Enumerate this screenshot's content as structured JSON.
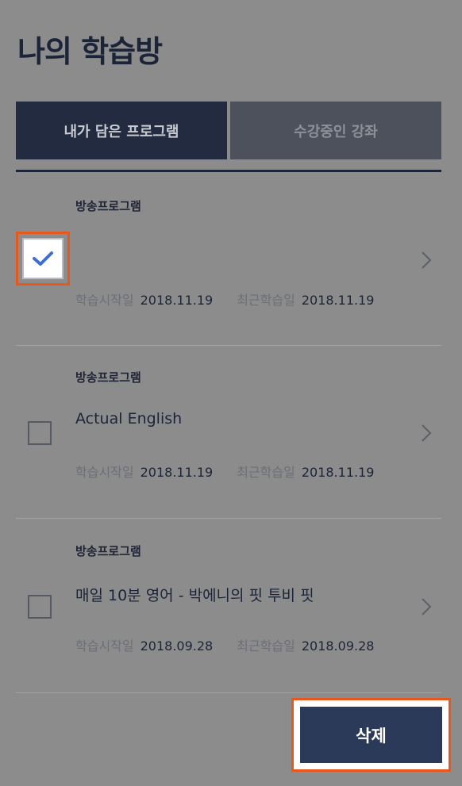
{
  "page_title": "나의 학습방",
  "tabs": [
    {
      "label": "내가 담은 프로그램",
      "active": true
    },
    {
      "label": "수강중인 강좌",
      "active": false
    }
  ],
  "items": [
    {
      "category": "방송프로그램",
      "name": "",
      "checked": true,
      "start_label": "학습시작일",
      "start_date": "2018.11.19",
      "recent_label": "최근학습일",
      "recent_date": "2018.11.19"
    },
    {
      "category": "방송프로그램",
      "name": "Actual English",
      "checked": false,
      "start_label": "학습시작일",
      "start_date": "2018.11.19",
      "recent_label": "최근학습일",
      "recent_date": "2018.11.19"
    },
    {
      "category": "방송프로그램",
      "name": "매일 10분 영어 - 박에니의 핏 투비 핏",
      "checked": false,
      "start_label": "학습시작일",
      "start_date": "2018.09.28",
      "recent_label": "최근학습일",
      "recent_date": "2018.09.28"
    }
  ],
  "delete_label": "삭제",
  "colors": {
    "accent_highlight": "#e8571c",
    "tab_active": "#222b40",
    "tab_inactive": "#4c515c",
    "delete_button": "#2c3a59",
    "check_mark": "#3b6fd6"
  }
}
